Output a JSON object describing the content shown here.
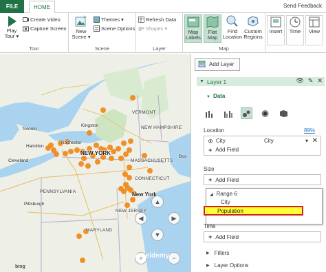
{
  "tabs": {
    "file": "FILE",
    "home": "HOME",
    "send_feedback": "Send Feedback"
  },
  "ribbon": {
    "tour": {
      "play_tour": "Play\nTour",
      "create_video": "Create Video",
      "capture_screen": "Capture Screen",
      "label": "Tour"
    },
    "scene": {
      "new_scene": "New\nScene",
      "themes": "Themes",
      "scene_options": "Scene Options",
      "label": "Scene"
    },
    "layer": {
      "refresh_data": "Refresh Data",
      "shapes": "Shapes",
      "label": "Layer"
    },
    "map": {
      "map_labels": "Map\nLabels",
      "flat_map": "Flat\nMap",
      "find_location": "Find\nLocation",
      "custom_regions": "Custom\nRegions",
      "label": "Map"
    },
    "insert": "Insert",
    "time": "Time",
    "view": "View"
  },
  "map": {
    "labels": {
      "vermont": "VERMONT",
      "kingston": "Kingston",
      "new_hampshire": "NEW HAMPSHIRE",
      "toronto": "Toronto",
      "hamilton": "Hamilton",
      "rochester": "Rochester",
      "new_york_state": "NEW YORK",
      "massachusetts": "MASSACHUSETTS",
      "boston": "Bos",
      "cleveland": "Cleveland",
      "connecticut": "CONNECTICUT",
      "pennsylvania": "PENNSYLVANIA",
      "new_york_city": "New York",
      "pittsburgh": "Pittsburgh",
      "new_jersey": "NEW JERSEY",
      "maryland": "MARYLAND",
      "bing": "bing",
      "watermark": "exceldemy"
    },
    "marker_color": "#f08a1c",
    "water_color": "#a9d3ee",
    "land_color": "#eef0e8",
    "nav": {
      "up": "▲",
      "down": "▼",
      "left": "◀",
      "right": "▶",
      "zoom_in": "+",
      "zoom_out": "−"
    }
  },
  "panel": {
    "add_layer": "Add Layer",
    "layer_title": "Layer 1",
    "data_section": "Data",
    "location_label": "Location",
    "location_pct": "89%",
    "location_field_name": "City",
    "location_field_type": "City",
    "add_field": "Add Field",
    "size_label": "Size",
    "size_add_field": "Add Field",
    "dropdown": {
      "range": "Range 6",
      "city": "City",
      "population": "Population"
    },
    "time_label": "Time",
    "time_add_field": "Add Field",
    "filters": "Filters",
    "layer_options": "Layer Options"
  },
  "colors": {
    "accent_green": "#217346",
    "highlight_yellow": "#ffff33",
    "highlight_border": "#d42020"
  }
}
